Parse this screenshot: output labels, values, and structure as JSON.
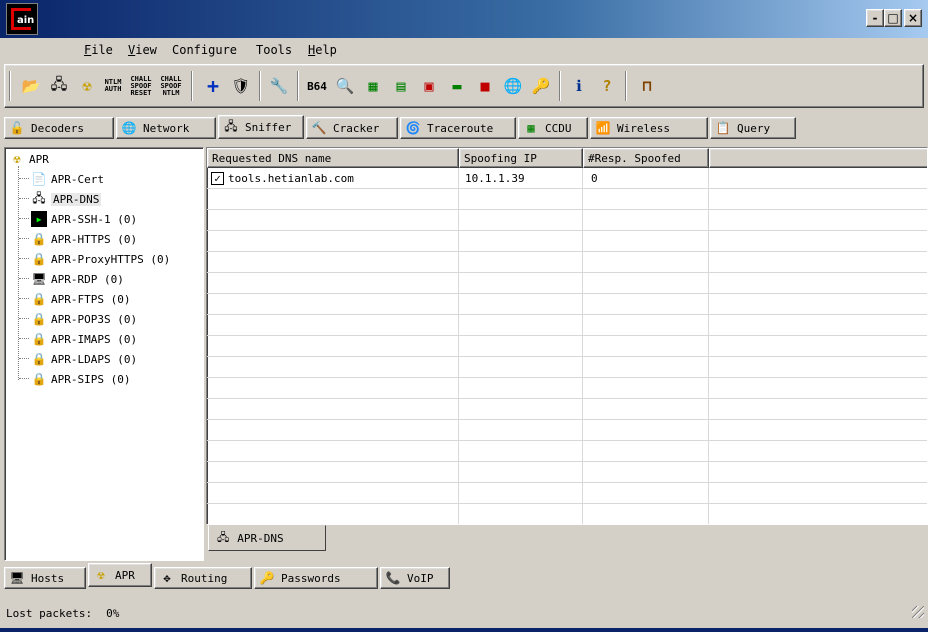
{
  "window": {
    "logo_text": "ain",
    "controls": {
      "minimize": "-",
      "maximize": "□",
      "close": "×"
    }
  },
  "menu": [
    {
      "label": "File",
      "mnemonic": "F",
      "rest": "ile"
    },
    {
      "label": "View",
      "mnemonic": "V",
      "rest": "iew"
    },
    {
      "label": "Configure",
      "mnemonic": "",
      "rest": "Configure"
    },
    {
      "label": "Tools",
      "mnemonic": "",
      "rest": "Tools"
    },
    {
      "label": "Help",
      "mnemonic": "H",
      "rest": "elp"
    }
  ],
  "toolbar": {
    "ntlm_auth": [
      "NTLM",
      "AUTH"
    ],
    "chall_spoof_reset": [
      "CHALL",
      "SPOOF",
      "RESET"
    ],
    "chall_spoof_ntlm": [
      "CHALL",
      "SPOOF",
      "NTLM"
    ],
    "base64": "B64"
  },
  "tabs": [
    {
      "label": "Decoders",
      "icon": "🔓"
    },
    {
      "label": "Network",
      "icon": "🌐"
    },
    {
      "label": "Sniffer",
      "icon": "🖧"
    },
    {
      "label": "Cracker",
      "icon": "🔨"
    },
    {
      "label": "Traceroute",
      "icon": "🌀"
    },
    {
      "label": "CCDU",
      "icon": "▦"
    },
    {
      "label": "Wireless",
      "icon": "📶"
    },
    {
      "label": "Query",
      "icon": "📋"
    }
  ],
  "tree": {
    "root": "APR",
    "items": [
      {
        "label": "APR-Cert",
        "icon": "📄"
      },
      {
        "label": "APR-DNS",
        "icon": "🖧"
      },
      {
        "label": "APR-SSH-1  (0)",
        "icon": "▶"
      },
      {
        "label": "APR-HTTPS  (0)",
        "icon": "🔒"
      },
      {
        "label": "APR-ProxyHTTPS  (0)",
        "icon": "🔒"
      },
      {
        "label": "APR-RDP  (0)",
        "icon": "🖥"
      },
      {
        "label": "APR-FTPS  (0)",
        "icon": "🔒"
      },
      {
        "label": "APR-POP3S  (0)",
        "icon": "🔒"
      },
      {
        "label": "APR-IMAPS  (0)",
        "icon": "🔒"
      },
      {
        "label": "APR-LDAPS  (0)",
        "icon": "🔒"
      },
      {
        "label": "APR-SIPS  (0)",
        "icon": "🔒"
      }
    ]
  },
  "grid": {
    "columns": [
      "Requested DNS name",
      "Spoofing IP",
      "#Resp. Spoofed"
    ],
    "rows": [
      {
        "checked": true,
        "name": "tools.hetianlab.com",
        "ip": "10.1.1.39",
        "resp": "0"
      }
    ]
  },
  "grid_tab": "APR-DNS",
  "bottom_tabs": [
    {
      "label": "Hosts",
      "icon": "🖥"
    },
    {
      "label": "APR",
      "icon": "☢"
    },
    {
      "label": "Routing",
      "icon": "✥"
    },
    {
      "label": "Passwords",
      "icon": "🔑"
    },
    {
      "label": "VoIP",
      "icon": "📞"
    }
  ],
  "status": {
    "label": "Lost packets:",
    "value": "0%"
  }
}
